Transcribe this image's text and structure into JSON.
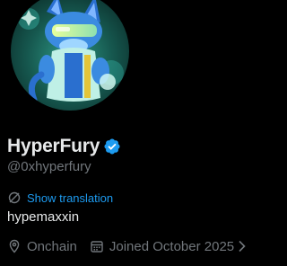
{
  "profile": {
    "display_name": "HyperFury",
    "handle": "@0xhyperfury",
    "verified": true,
    "bio": "hypemaxxin",
    "translate_label": "Show translation",
    "location": "Onchain",
    "joined": "Joined October 2025"
  },
  "icons": {
    "verified": "verified-badge-icon",
    "translate": "translate-icon",
    "location": "location-pin-icon",
    "calendar": "calendar-icon",
    "more": "chevron-right-icon"
  },
  "colors": {
    "background": "#000000",
    "primary_text": "#e7e9ea",
    "secondary_text": "#71767b",
    "accent": "#1d9bf0"
  }
}
